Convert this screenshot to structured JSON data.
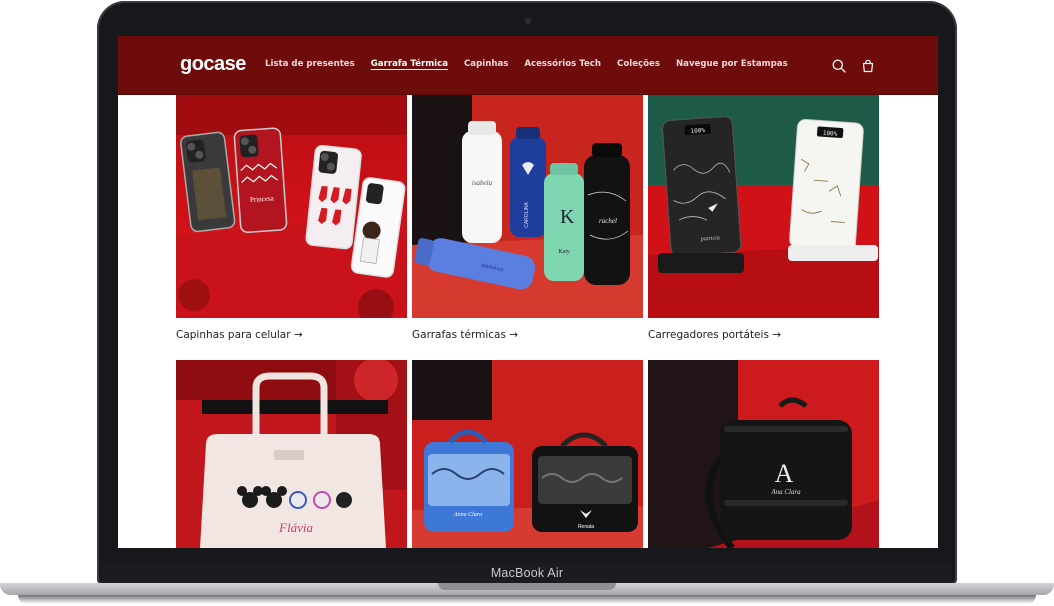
{
  "laptop": {
    "label": "MacBook Air"
  },
  "header": {
    "logo": "gocase",
    "nav": [
      {
        "label": "Lista de presentes",
        "active": false
      },
      {
        "label": "Garrafa Térmica",
        "active": true
      },
      {
        "label": "Capinhas",
        "active": false
      },
      {
        "label": "Acessórios Tech",
        "active": false
      },
      {
        "label": "Coleções",
        "active": false
      },
      {
        "label": "Navegue por Estampas",
        "active": false
      }
    ],
    "icons": [
      "search-icon",
      "cart-icon"
    ]
  },
  "collections": [
    {
      "title": "Capinhas para celular →"
    },
    {
      "title": "Garrafas térmicas →"
    },
    {
      "title": "Carregadores portáteis →"
    }
  ],
  "product_texts": {
    "phone_case": "Princesa",
    "bottle_1": "isabela",
    "bottle_2": "CAROLINA",
    "bottle_3": "Katy",
    "bottle_4": "rachel",
    "blue_bottle": "MARIANA",
    "charger_1": "patricia",
    "charger_display_1": "100%",
    "charger_display_2": "100%",
    "bag_name": "Flávia",
    "cosmetic_bag_1": "Anna Clara",
    "cosmetic_bag_2": "Renata",
    "lunch_bag": "Ana Clara"
  },
  "colors": {
    "header": "#6e0b0b",
    "accent_red": "#c8161a",
    "text": "#222222"
  }
}
